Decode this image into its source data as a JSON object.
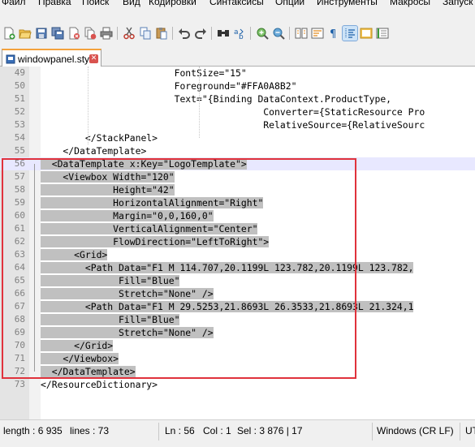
{
  "menu": {
    "items": [
      "Файл",
      "Правка",
      "Поиск",
      "Вид",
      "Кодировки",
      "Синтаксисы",
      "Опции",
      "Инструменты",
      "Макросы",
      "Запуск"
    ]
  },
  "toolbar": {
    "icons": [
      "new-file-icon",
      "open-icon",
      "save-icon",
      "save-all-icon",
      "close-icon",
      "close-all-icon",
      "print-icon",
      "cut-icon",
      "copy-icon",
      "paste-icon",
      "undo-icon",
      "redo-icon",
      "find-icon",
      "replace-icon",
      "zoom-in-icon",
      "zoom-out-icon",
      "sync-scroll-icon",
      "word-wrap-icon",
      "show-all-chars-icon",
      "indent-guide-icon",
      "doc-map-icon",
      "function-list-icon"
    ]
  },
  "tab": {
    "label": "windowpanel.style",
    "close_glyph": "✕"
  },
  "editor": {
    "lines": [
      {
        "num": "49",
        "code": "                        FontSize=\"15\""
      },
      {
        "num": "50",
        "code": "                        Foreground=\"#FFA0A8B2\""
      },
      {
        "num": "51",
        "code": "                        Text=\"{Binding DataContext.ProductType,"
      },
      {
        "num": "52",
        "code": "                                        Converter={StaticResource Pro"
      },
      {
        "num": "53",
        "code": "                                        RelativeSource={RelativeSourc"
      },
      {
        "num": "54",
        "code": "        </StackPanel>"
      },
      {
        "num": "55",
        "code": "    </DataTemplate>"
      },
      {
        "num": "56",
        "code": "  <DataTemplate x:Key=\"LogoTemplate\">"
      },
      {
        "num": "57",
        "code": "    <Viewbox Width=\"120\""
      },
      {
        "num": "58",
        "code": "             Height=\"42\""
      },
      {
        "num": "59",
        "code": "             HorizontalAlignment=\"Right\""
      },
      {
        "num": "60",
        "code": "             Margin=\"0,0,160,0\""
      },
      {
        "num": "61",
        "code": "             VerticalAlignment=\"Center\""
      },
      {
        "num": "62",
        "code": "             FlowDirection=\"LeftToRight\">"
      },
      {
        "num": "63",
        "code": "      <Grid>"
      },
      {
        "num": "64",
        "code": "        <Path Data=\"F1 M 114.707,20.1199L 123.782,20.1199L 123.782,"
      },
      {
        "num": "65",
        "code": "              Fill=\"Blue\""
      },
      {
        "num": "66",
        "code": "              Stretch=\"None\" />"
      },
      {
        "num": "67",
        "code": "        <Path Data=\"F1 M 29.5253,21.8693L 26.3533,21.8693L 21.324,1"
      },
      {
        "num": "68",
        "code": "              Fill=\"Blue\""
      },
      {
        "num": "69",
        "code": "              Stretch=\"None\" />"
      },
      {
        "num": "70",
        "code": "      </Grid>"
      },
      {
        "num": "71",
        "code": "    </Viewbox>"
      },
      {
        "num": "72",
        "code": "  </DataTemplate>"
      },
      {
        "num": "73",
        "code": "</ResourceDictionary>"
      }
    ]
  },
  "status": {
    "length": "length : 6 935",
    "lines": "lines : 73",
    "ln": "Ln : 56",
    "col": "Col : 1",
    "sel": "Sel : 3 876 | 17",
    "eol": "Windows (CR LF)",
    "enc": "UTF"
  },
  "colors": {
    "selection": "#c0c0c0",
    "current_line": "#e8e8ff",
    "annotation_box": "#e0323c",
    "tab_accent": "#f4a23c"
  }
}
